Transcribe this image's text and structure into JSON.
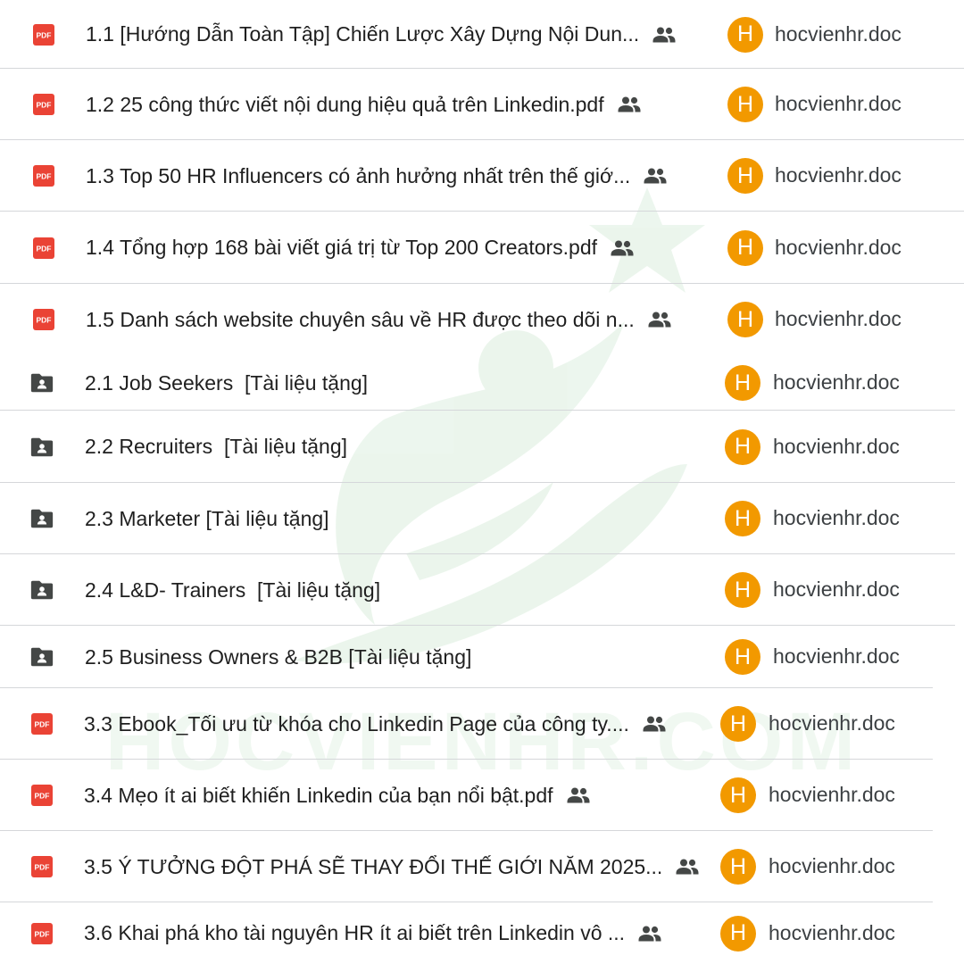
{
  "owner_name": "hocvienhr.doc",
  "avatar_letter": "H",
  "watermark_text": "HOCVIENHR.COM",
  "colors": {
    "pdf_red": "#ea4335",
    "folder_gray": "#444746",
    "avatar_orange": "#f29900",
    "watermark_green": "#2e9e3e"
  },
  "files": [
    {
      "type": "pdf",
      "icon": "pdf-icon",
      "name": "1.1 [Hướng Dẫn Toàn Tập] Chiến Lược Xây Dựng Nội Dun...",
      "shared": true
    },
    {
      "type": "pdf",
      "icon": "pdf-icon",
      "name": "1.2 25 công thức viết nội dung hiệu quả trên Linkedin.pdf",
      "shared": true
    },
    {
      "type": "pdf",
      "icon": "pdf-icon",
      "name": "1.3 Top 50 HR Influencers có ảnh hưởng nhất trên thế giớ...",
      "shared": true
    },
    {
      "type": "pdf",
      "icon": "pdf-icon",
      "name": "1.4 Tổng hợp 168 bài viết giá trị từ Top 200 Creators.pdf",
      "shared": true
    },
    {
      "type": "pdf",
      "icon": "pdf-icon",
      "name": "1.5 Danh sách website chuyên sâu về HR được theo dõi n...",
      "shared": true
    },
    {
      "type": "folder",
      "icon": "shared-folder-icon",
      "name": "2.1 Job Seekers  [Tài liệu tặng]",
      "shared": false
    },
    {
      "type": "folder",
      "icon": "shared-folder-icon",
      "name": "2.2 Recruiters  [Tài liệu tặng]",
      "shared": false
    },
    {
      "type": "folder",
      "icon": "shared-folder-icon",
      "name": "2.3 Marketer [Tài liệu tặng]",
      "shared": false
    },
    {
      "type": "folder",
      "icon": "shared-folder-icon",
      "name": "2.4 L&D- Trainers  [Tài liệu tặng]",
      "shared": false
    },
    {
      "type": "folder",
      "icon": "shared-folder-icon",
      "name": "2.5 Business Owners & B2B [Tài liệu tặng]",
      "shared": false
    },
    {
      "type": "pdf",
      "icon": "pdf-icon",
      "name": "3.3 Ebook_Tối ưu từ khóa cho Linkedin Page của công ty....",
      "shared": true
    },
    {
      "type": "pdf",
      "icon": "pdf-icon",
      "name": "3.4 Mẹo ít ai biết khiến Linkedin của bạn nổi bật.pdf",
      "shared": true
    },
    {
      "type": "pdf",
      "icon": "pdf-icon",
      "name": "3.5 Ý TƯỞNG ĐỘT PHÁ SẼ THAY ĐỔI THẾ GIỚI NĂM 2025...",
      "shared": true
    },
    {
      "type": "pdf",
      "icon": "pdf-icon",
      "name": "3.6 Khai phá kho tài nguyên HR ít ai biết trên Linkedin vô ...",
      "shared": true
    }
  ]
}
